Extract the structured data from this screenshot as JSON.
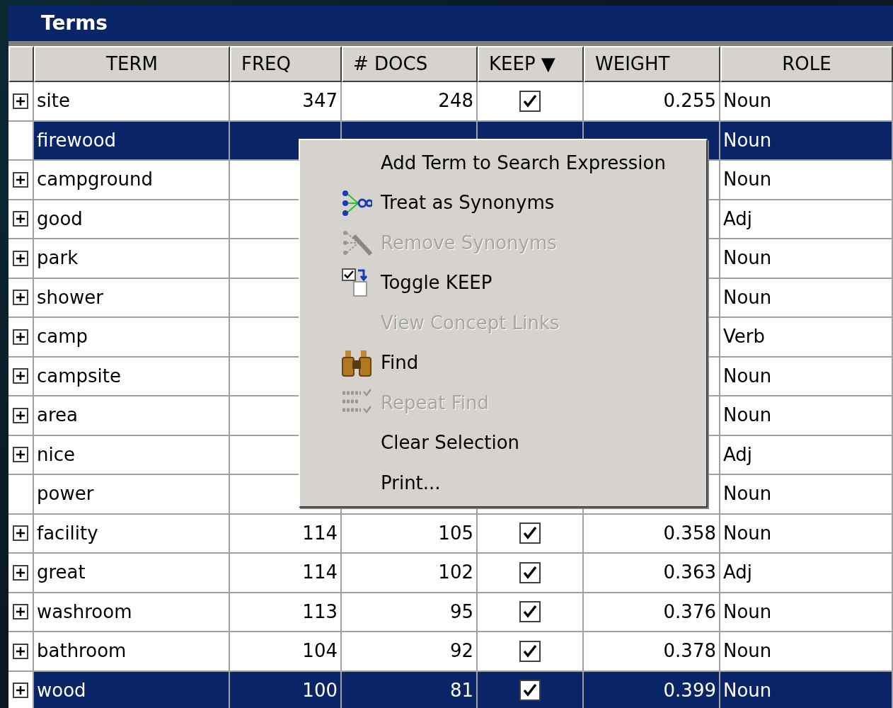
{
  "window": {
    "title": "Terms"
  },
  "table": {
    "columns": [
      {
        "label": "TERM"
      },
      {
        "label": "FREQ"
      },
      {
        "label": "# DOCS"
      },
      {
        "label": "KEEP ▼"
      },
      {
        "label": "WEIGHT"
      },
      {
        "label": "ROLE"
      }
    ],
    "rows": [
      {
        "expandable": true,
        "selected": false,
        "term": "site",
        "freq": "347",
        "docs": "248",
        "keep": true,
        "weight": "0.255",
        "role": "Noun"
      },
      {
        "expandable": false,
        "selected": true,
        "term": "firewood",
        "role": "Noun"
      },
      {
        "expandable": true,
        "selected": false,
        "term": "campground",
        "role": "Noun"
      },
      {
        "expandable": true,
        "selected": false,
        "term": "good",
        "role": "Adj"
      },
      {
        "expandable": true,
        "selected": false,
        "term": "park",
        "role": "Noun"
      },
      {
        "expandable": true,
        "selected": false,
        "term": "shower",
        "role": "Noun"
      },
      {
        "expandable": true,
        "selected": false,
        "term": "camp",
        "role": "Verb"
      },
      {
        "expandable": true,
        "selected": false,
        "term": "campsite",
        "role": "Noun"
      },
      {
        "expandable": true,
        "selected": false,
        "term": "area",
        "role": "Noun"
      },
      {
        "expandable": true,
        "selected": false,
        "term": "nice",
        "role": "Adj"
      },
      {
        "expandable": false,
        "selected": false,
        "term": "power",
        "role": "Noun"
      },
      {
        "expandable": true,
        "selected": false,
        "term": "facility",
        "freq": "114",
        "docs": "105",
        "keep": true,
        "weight": "0.358",
        "role": "Noun"
      },
      {
        "expandable": true,
        "selected": false,
        "term": "great",
        "freq": "114",
        "docs": "102",
        "keep": true,
        "weight": "0.363",
        "role": "Adj"
      },
      {
        "expandable": true,
        "selected": false,
        "term": "washroom",
        "freq": "113",
        "docs": "95",
        "keep": true,
        "weight": "0.376",
        "role": "Noun"
      },
      {
        "expandable": true,
        "selected": false,
        "term": "bathroom",
        "freq": "104",
        "docs": "92",
        "keep": true,
        "weight": "0.378",
        "role": "Noun"
      },
      {
        "expandable": true,
        "selected": true,
        "term": "wood",
        "freq": "100",
        "docs": "81",
        "keep": true,
        "weight": "0.399",
        "role": "Noun"
      }
    ]
  },
  "context_menu": {
    "items": [
      {
        "label": "Add Term to Search Expression",
        "kind": "plain",
        "disabled": false
      },
      {
        "label": "Treat as Synonyms",
        "kind": "synonyms",
        "disabled": false
      },
      {
        "label": "Remove Synonyms",
        "kind": "remove-synonyms",
        "disabled": true
      },
      {
        "label": "Toggle KEEP",
        "kind": "toggle",
        "disabled": false
      },
      {
        "label": "View Concept Links",
        "kind": "plain",
        "disabled": true
      },
      {
        "label": "Find",
        "kind": "find",
        "disabled": false
      },
      {
        "label": "Repeat Find",
        "kind": "repeat-find",
        "disabled": true
      },
      {
        "label": "Clear Selection",
        "kind": "plain",
        "disabled": false
      },
      {
        "label": "Print...",
        "kind": "plain",
        "disabled": false
      }
    ]
  }
}
